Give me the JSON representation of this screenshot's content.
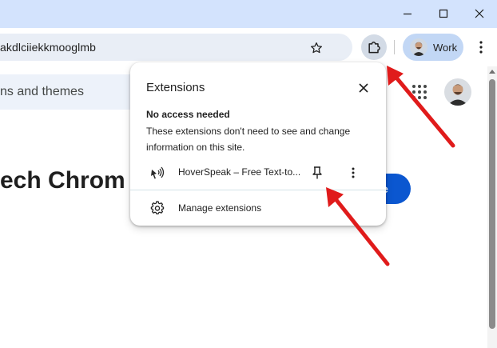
{
  "browser": {
    "address_bar": {
      "url": "akdlciiekkmooglmb"
    },
    "profile": {
      "label": "Work"
    }
  },
  "page": {
    "search_text": "ns and themes",
    "heading": "ech Chrom",
    "button_label": "e"
  },
  "extensions_popup": {
    "title": "Extensions",
    "section_heading": "No access needed",
    "section_description": "These extensions don't need to see and change information on this site.",
    "extension": {
      "name": "HoverSpeak – Free Text-to..."
    },
    "manage_label": "Manage extensions"
  },
  "colors": {
    "titlebar": "#d3e3fd",
    "omnibox": "#e9eef6",
    "profile_chip": "#c2d7f5",
    "accent_button": "#0b57d0",
    "annotation_arrow": "#e01b1b"
  },
  "icons": [
    "minimize-icon",
    "maximize-icon",
    "close-window-icon",
    "star-icon",
    "puzzle-icon",
    "kebab-menu-icon",
    "apps-grid-icon",
    "close-icon",
    "speaker-icon",
    "pin-icon",
    "gear-icon"
  ]
}
